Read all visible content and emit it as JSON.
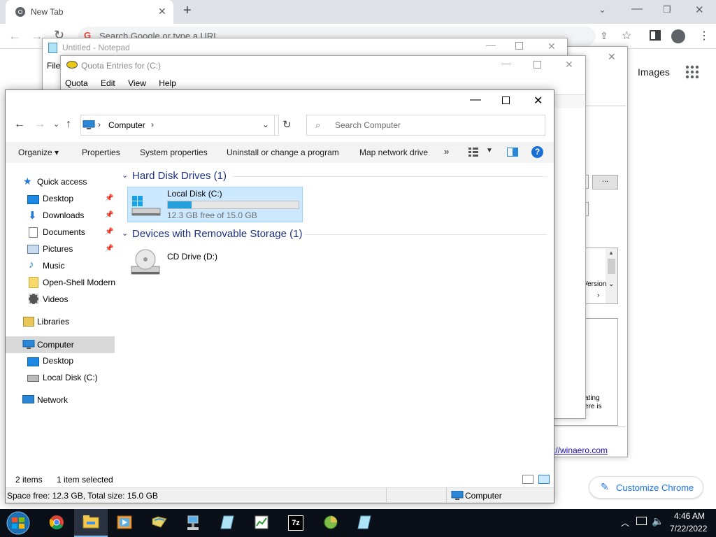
{
  "chrome": {
    "tab_title": "New Tab",
    "omnibox_placeholder": "Search Google or type a URL",
    "images_link": "Images",
    "customize_label": "Customize Chrome",
    "winaero_link": "://winaero.com"
  },
  "notepad": {
    "title": "Untitled - Notepad",
    "menu_file": "File"
  },
  "quota": {
    "title": "Quota Entries for  (C:)",
    "menu": [
      "Quota",
      "Edit",
      "View",
      "Help"
    ]
  },
  "bg_dialog": {
    "browse_label": "...",
    "version_label": "Version",
    "text_1": "ating",
    "text_2": "ere is"
  },
  "explorer": {
    "address_segment": "Computer",
    "search_placeholder": "Search Computer",
    "ribbon": {
      "organize": "Organize",
      "properties": "Properties",
      "system_properties": "System properties",
      "uninstall": "Uninstall or change a program",
      "map_drive": "Map network drive",
      "more": "»"
    },
    "nav": {
      "quick_access": "Quick access",
      "desktop": "Desktop",
      "downloads": "Downloads",
      "documents": "Documents",
      "pictures": "Pictures",
      "music": "Music",
      "open_shell": "Open-Shell Modern",
      "videos": "Videos",
      "libraries": "Libraries",
      "computer": "Computer",
      "computer_desktop": "Desktop",
      "local_disk": "Local Disk (C:)",
      "network": "Network"
    },
    "groups": {
      "hdd": "Hard Disk Drives (1)",
      "removable": "Devices with Removable Storage (1)"
    },
    "drives": {
      "c_name": "Local Disk (C:)",
      "c_free": "12.3 GB free of 15.0 GB",
      "c_used_fraction": 0.18,
      "d_name": "CD Drive (D:)"
    },
    "status": {
      "items": "2 items",
      "selected": "1 item selected",
      "space": "Space free: 12.3 GB, Total size: 15.0 GB",
      "location": "Computer"
    }
  },
  "taskbar": {
    "time": "4:46 AM",
    "date": "7/22/2022",
    "sevenzip_label": "7z"
  },
  "colors": {
    "accent": "#0078d7",
    "selection": "#cce8ff",
    "progress": "#26a0da",
    "taskbar": "#0b0f18"
  }
}
